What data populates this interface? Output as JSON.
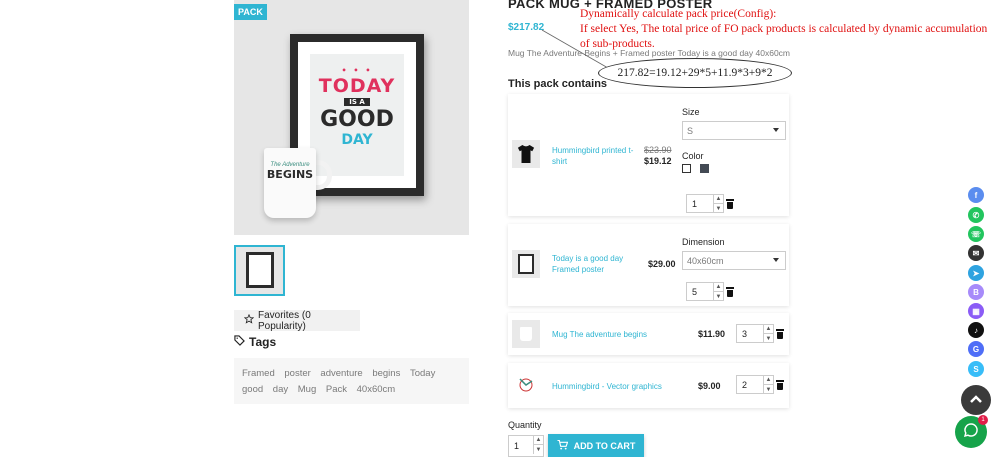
{
  "product": {
    "badge": "PACK",
    "title": "PACK MUG + FRAMED POSTER",
    "price": "$217.82",
    "description": "Mug The Adventure Begins + Framed poster Today is a good day 40x60cm",
    "poster_lines": [
      "TODAY",
      "IS A",
      "GOOD",
      "DAY"
    ],
    "mug_lines": [
      "The Adventure",
      "BEGINS"
    ]
  },
  "annotation": {
    "line1": "Dynamically calculate pack price(Config):",
    "line2": "If select Yes, The total price of FO pack products is calculated by dynamic accumulation of sub-products.",
    "formula": "217.82=19.12+29*5+11.9*3+9*2"
  },
  "favorites_label": "Favorites (0 Popularity)",
  "tags": {
    "title": "Tags",
    "items": [
      "Framed",
      "poster",
      "adventure",
      "begins",
      "Today",
      "good",
      "day",
      "Mug",
      "Pack",
      "40x60cm"
    ]
  },
  "pack": {
    "heading": "This pack contains",
    "items": [
      {
        "name": "Hummingbird printed t-shirt",
        "old_price": "$23.90",
        "price": "$19.12",
        "size_label": "Size",
        "size_value": "S",
        "color_label": "Color",
        "qty": "1"
      },
      {
        "name": "Today is a good day Framed poster",
        "price": "$29.00",
        "dimension_label": "Dimension",
        "dimension_value": "40x60cm",
        "qty": "5"
      },
      {
        "name": "Mug The adventure begins",
        "price": "$11.90",
        "qty": "3"
      },
      {
        "name": "Hummingbird - Vector graphics",
        "price": "$9.00",
        "qty": "2"
      }
    ]
  },
  "cart": {
    "quantity_label": "Quantity",
    "qty": "1",
    "add_label": "ADD TO CART"
  },
  "social": [
    {
      "name": "facebook",
      "color": "#5b8def"
    },
    {
      "name": "whatsapp",
      "color": "#22c55e"
    },
    {
      "name": "phone",
      "color": "#22c55e"
    },
    {
      "name": "email",
      "color": "#333333"
    },
    {
      "name": "telegram",
      "color": "#2fa3e0"
    },
    {
      "name": "bootstrap",
      "color": "#a78bfa"
    },
    {
      "name": "apps",
      "color": "#8b5cf6"
    },
    {
      "name": "tiktok",
      "color": "#111111"
    },
    {
      "name": "google",
      "color": "#4f6ef7"
    },
    {
      "name": "skype",
      "color": "#38bdf8"
    }
  ],
  "chat_badge": "1",
  "colors": {
    "accent": "#2fb5d2",
    "annotation": "#e01010"
  }
}
